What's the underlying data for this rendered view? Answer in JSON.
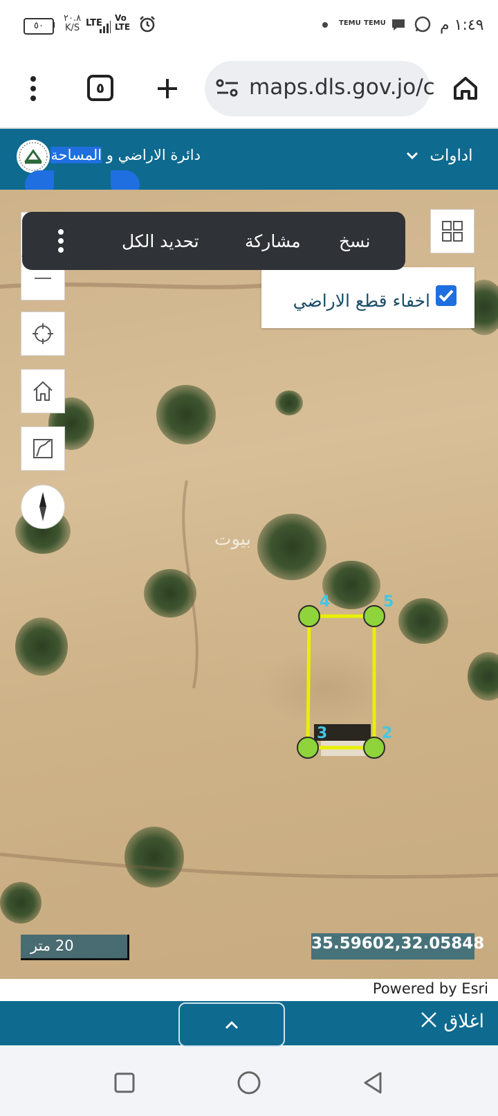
{
  "status_bar": {
    "time": "١:٤٩ م",
    "battery": "٥٠",
    "net_speed_value": "٢٠.٨",
    "net_speed_unit": "K/S",
    "lte_label": "LTE",
    "volte_label_top": "Vo",
    "volte_label_bottom": "LTE",
    "notif_temu": "TEMU"
  },
  "browser": {
    "tab_count": "٥",
    "url": "maps.dls.gov.jo/c"
  },
  "app_header": {
    "title_part1": "دائرة الاراضي و ",
    "title_selected": "المساحة",
    "tools_label": "اداوات"
  },
  "popup_menu": {
    "copy": "نسخ",
    "share": "مشاركة",
    "select_all": "تحديد الكل"
  },
  "layer_panel": {
    "hide_parcels_label": "اخفاء قطع الاراضي",
    "checked": true
  },
  "map": {
    "watermark": "بيوت",
    "parcel_color": "#e8f000",
    "vertex_color": "#8fd43a",
    "vertex_labels": [
      "4",
      "5",
      "3",
      "2"
    ],
    "scale_label": "20 متر",
    "coordinates": "35.59602,32.05848",
    "attribution": "Powered by Esri"
  },
  "bottom_bar": {
    "close_label": "اغلاق"
  },
  "colors": {
    "header_bg": "#0e6a8f",
    "selection": "#1f6fe0"
  }
}
